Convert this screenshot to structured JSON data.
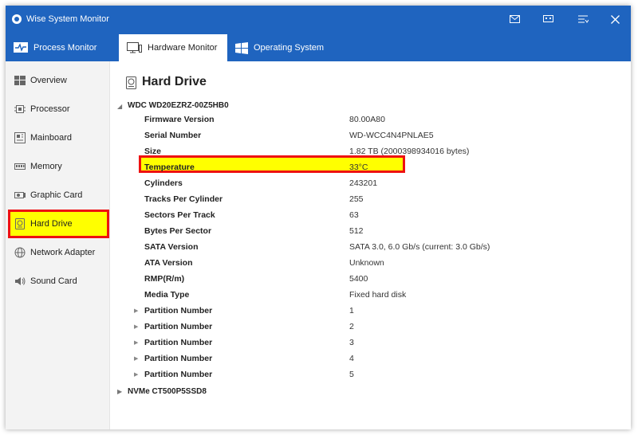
{
  "window": {
    "title": "Wise System Monitor"
  },
  "titlebar_buttons": [
    "mail-icon",
    "feedback-icon",
    "menu-icon",
    "close-icon"
  ],
  "tabs": [
    {
      "label": "Process Monitor",
      "icon": "process-monitor-icon"
    },
    {
      "label": "Hardware Monitor",
      "icon": "hardware-monitor-icon",
      "active": true
    },
    {
      "label": "Operating System",
      "icon": "windows-logo-icon"
    }
  ],
  "sidebar": {
    "items": [
      {
        "label": "Overview",
        "icon": "overview-icon"
      },
      {
        "label": "Processor",
        "icon": "processor-icon"
      },
      {
        "label": "Mainboard",
        "icon": "mainboard-icon"
      },
      {
        "label": "Memory",
        "icon": "memory-icon"
      },
      {
        "label": "Graphic Card",
        "icon": "graphic-card-icon"
      },
      {
        "label": "Hard Drive",
        "icon": "hard-drive-icon",
        "active": true
      },
      {
        "label": "Network Adapter",
        "icon": "network-adapter-icon"
      },
      {
        "label": "Sound Card",
        "icon": "sound-card-icon"
      }
    ]
  },
  "main": {
    "title": "Hard Drive",
    "devices": [
      {
        "name": "WDC WD20EZRZ-00Z5HB0",
        "expanded": true,
        "properties": [
          {
            "key": "Firmware Version",
            "value": "80.00A80"
          },
          {
            "key": "Serial Number",
            "value": "WD-WCC4N4PNLAE5"
          },
          {
            "key": "Size",
            "value": "1.82 TB (2000398934016 bytes)"
          },
          {
            "key": "Temperature",
            "value": "33°C",
            "highlighted": true
          },
          {
            "key": "Cylinders",
            "value": "243201"
          },
          {
            "key": "Tracks Per Cylinder",
            "value": "255"
          },
          {
            "key": "Sectors Per Track",
            "value": "63"
          },
          {
            "key": "Bytes Per Sector",
            "value": "512"
          },
          {
            "key": "SATA Version",
            "value": "SATA 3.0, 6.0 Gb/s (current: 3.0 Gb/s)"
          },
          {
            "key": "ATA Version",
            "value": "Unknown"
          },
          {
            "key": "RMP(R/m)",
            "value": "5400"
          },
          {
            "key": "Media Type",
            "value": "Fixed hard disk"
          },
          {
            "key": "Partition Number",
            "value": "1",
            "expandable": true
          },
          {
            "key": "Partition Number",
            "value": "2",
            "expandable": true
          },
          {
            "key": "Partition Number",
            "value": "3",
            "expandable": true
          },
          {
            "key": "Partition Number",
            "value": "4",
            "expandable": true
          },
          {
            "key": "Partition Number",
            "value": "5",
            "expandable": true
          }
        ]
      },
      {
        "name": "NVMe   CT500P5SSD8",
        "expanded": false
      }
    ]
  },
  "colors": {
    "accent": "#1f64bf",
    "highlight": "#ffff00",
    "highlight_border": "#ee1111"
  }
}
